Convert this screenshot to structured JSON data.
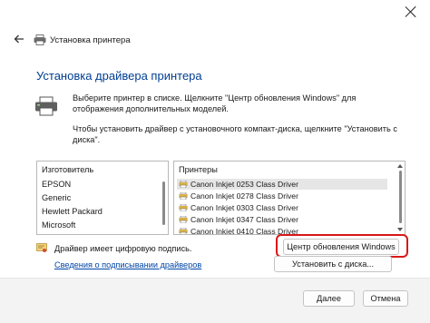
{
  "window": {
    "title": "Установка принтера",
    "heading": "Установка драйвера принтера",
    "description_1": "Выберите принтер в списке. Щелкните \"Центр обновления Windows\" для отображения дополнительных моделей.",
    "description_2": "Чтобы установить драйвер с установочного компакт-диска, щелкните \"Установить с диска\"."
  },
  "manufacturers": {
    "header": "Изготовитель",
    "items": [
      "EPSON",
      "Generic",
      "Hewlett Packard",
      "Microsoft"
    ]
  },
  "printers": {
    "header": "Принтеры",
    "items": [
      "Canon Inkjet 0253 Class Driver",
      "Canon Inkjet 0278 Class Driver",
      "Canon Inkjet 0303 Class Driver",
      "Canon Inkjet 0347 Class Driver",
      "Canon Inkjet 0410 Class Driver"
    ]
  },
  "signature": {
    "text": "Драйвер имеет цифровую подпись.",
    "link": "Сведения о подписывании драйверов"
  },
  "buttons": {
    "windows_update": "Центр обновления Windows",
    "have_disk": "Установить с диска...",
    "next": "Далее",
    "cancel": "Отмена"
  },
  "colors": {
    "heading": "#003e92",
    "link": "#0045a8",
    "highlight": "#d81818"
  }
}
